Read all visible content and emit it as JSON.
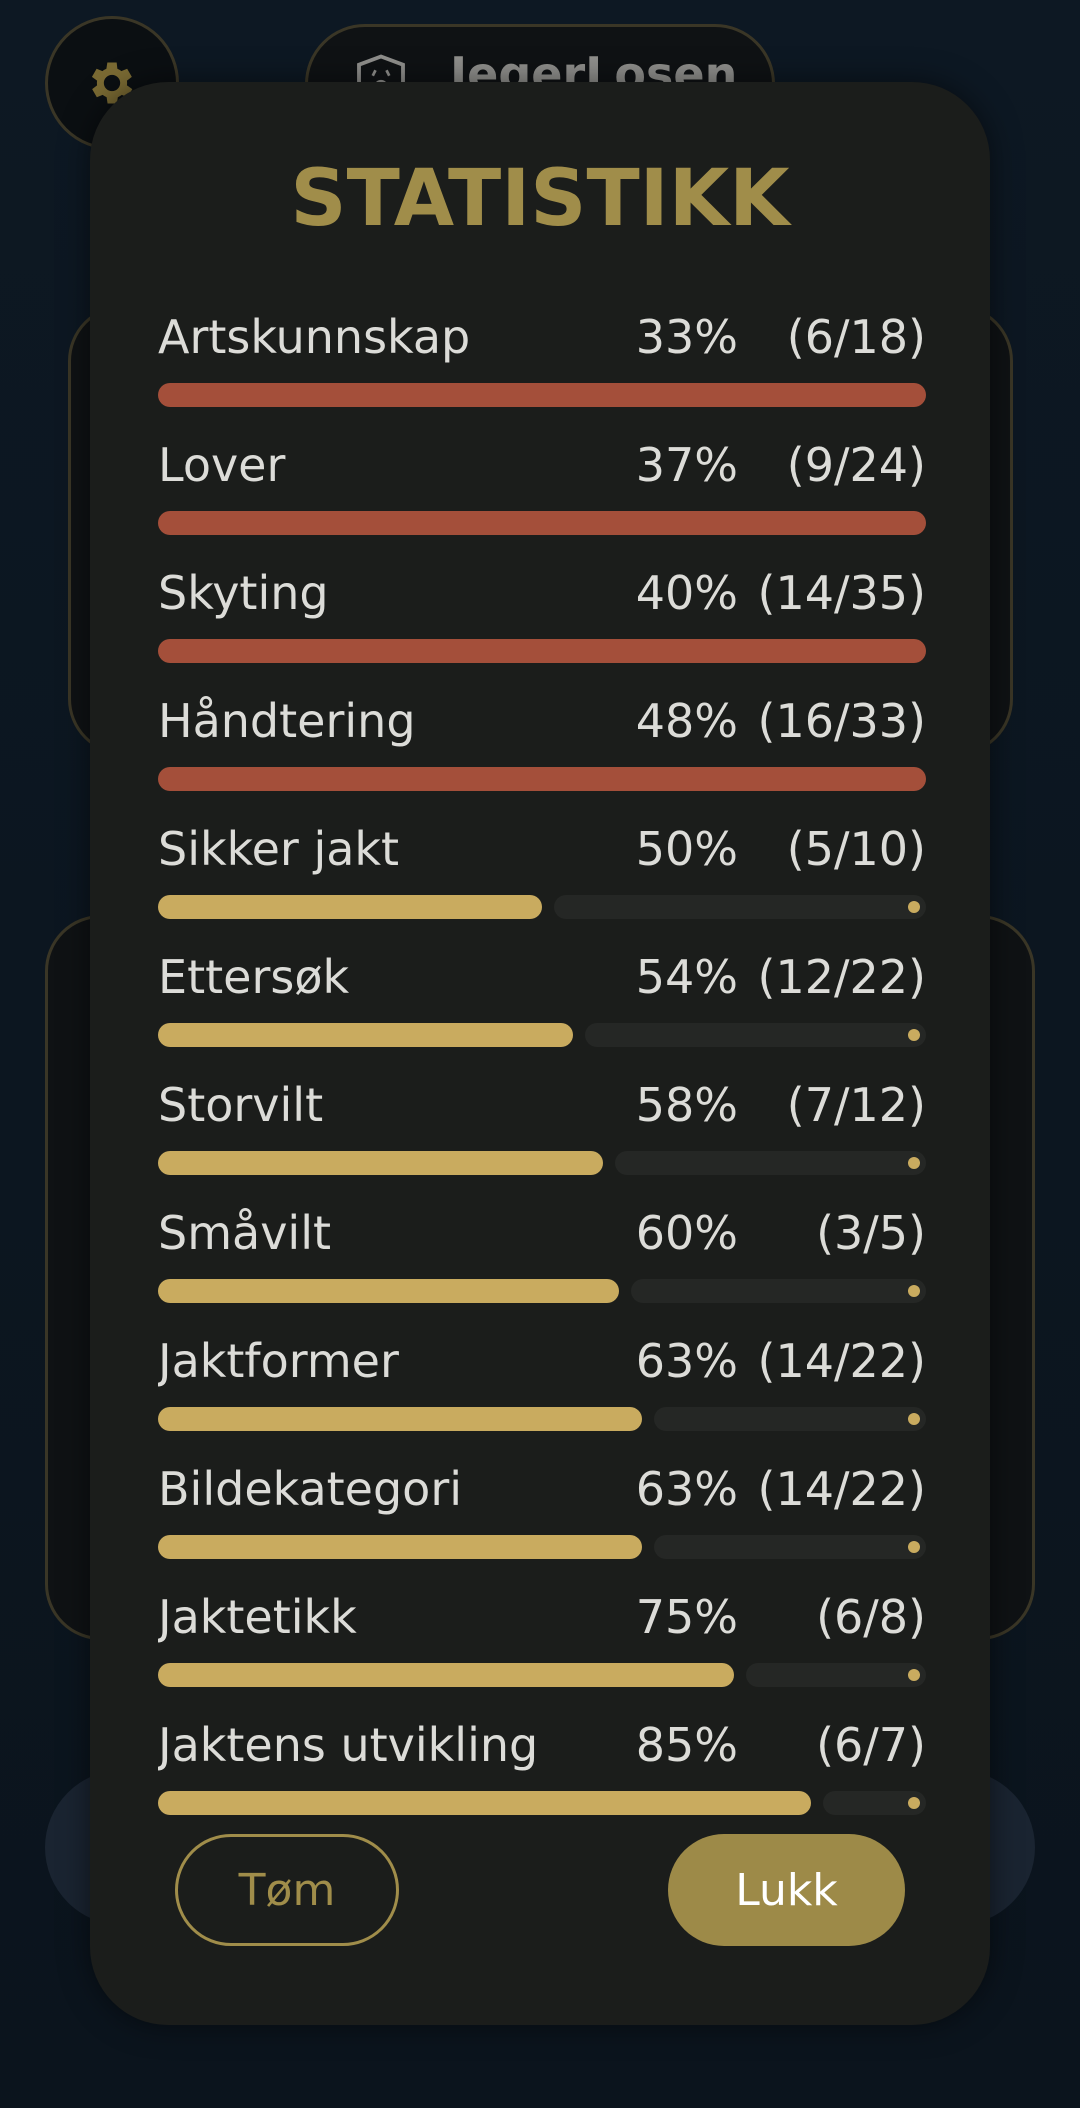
{
  "header": {
    "settings_icon": "gear-icon",
    "logo_icon": "deer-shield-icon",
    "app_title": "JegerLosen"
  },
  "modal": {
    "title": "STATISTIKK",
    "clear_label": "Tøm",
    "close_label": "Lukk"
  },
  "colors": {
    "low": "#a44f3a",
    "high": "#c9ab5f",
    "accent": "#a08d4a"
  },
  "stats": [
    {
      "label": "Artskunnskap",
      "percent": "33%",
      "count": "(6/18)",
      "fill": 1.0,
      "level": "low"
    },
    {
      "label": "Lover",
      "percent": "37%",
      "count": "(9/24)",
      "fill": 1.0,
      "level": "low"
    },
    {
      "label": "Skyting",
      "percent": "40%",
      "count": "(14/35)",
      "fill": 1.0,
      "level": "low"
    },
    {
      "label": "Håndtering",
      "percent": "48%",
      "count": "(16/33)",
      "fill": 1.0,
      "level": "low"
    },
    {
      "label": "Sikker jakt",
      "percent": "50%",
      "count": "(5/10)",
      "fill": 0.5,
      "level": "high"
    },
    {
      "label": "Ettersøk",
      "percent": "54%",
      "count": "(12/22)",
      "fill": 0.54,
      "level": "high"
    },
    {
      "label": "Storvilt",
      "percent": "58%",
      "count": "(7/12)",
      "fill": 0.58,
      "level": "high"
    },
    {
      "label": "Småvilt",
      "percent": "60%",
      "count": "(3/5)",
      "fill": 0.6,
      "level": "high"
    },
    {
      "label": "Jaktformer",
      "percent": "63%",
      "count": "(14/22)",
      "fill": 0.63,
      "level": "high"
    },
    {
      "label": "Bildekategori",
      "percent": "63%",
      "count": "(14/22)",
      "fill": 0.63,
      "level": "high"
    },
    {
      "label": "Jaktetikk",
      "percent": "75%",
      "count": "(6/8)",
      "fill": 0.75,
      "level": "high"
    },
    {
      "label": "Jaktens utvikling",
      "percent": "85%",
      "count": "(6/7)",
      "fill": 0.85,
      "level": "high"
    }
  ]
}
